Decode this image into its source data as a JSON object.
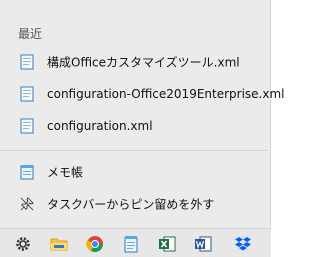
{
  "jumplist": {
    "section_title": "最近",
    "recent_items": [
      {
        "label": "構成Officeカスタマイズツール.xml",
        "icon": "document-icon"
      },
      {
        "label": "configuration-Office2019Enterprise.xml",
        "icon": "document-icon"
      },
      {
        "label": "configuration.xml",
        "icon": "document-icon"
      }
    ],
    "tasks": [
      {
        "label": "メモ帳",
        "icon": "notepad-icon"
      },
      {
        "label": "タスクバーからピン留めを外す",
        "icon": "unpin-icon"
      }
    ]
  },
  "taskbar": {
    "icons": [
      "settings-icon",
      "file-explorer-icon",
      "chrome-icon",
      "notepad-icon",
      "excel-icon",
      "word-icon",
      "dropbox-icon"
    ]
  },
  "colors": {
    "menu_bg": "#ebebeb",
    "taskbar_bg": "#e7e7e7",
    "excel_green": "#1d7044",
    "word_blue": "#2b579a",
    "dropbox_blue": "#0061fe"
  }
}
